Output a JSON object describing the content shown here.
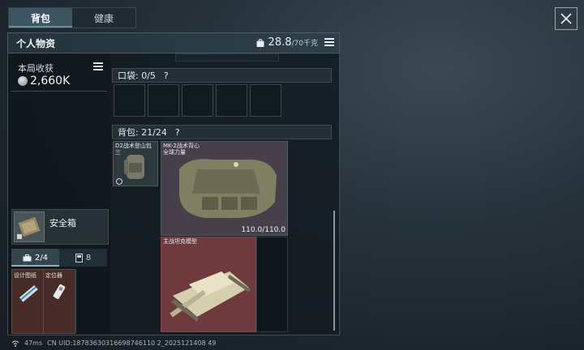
{
  "tabs": [
    {
      "label": "背包"
    },
    {
      "label": "健康"
    }
  ],
  "header": {
    "title": "个人物资",
    "weight_value": "28.8",
    "weight_max": "/70千克"
  },
  "earnings": {
    "label": "本局收获",
    "value": "2,660K"
  },
  "safebox": {
    "label": "安全箱"
  },
  "subtabs": [
    {
      "label": "2/4"
    },
    {
      "label": "8"
    }
  ],
  "tools": [
    {
      "label": "设计图纸"
    },
    {
      "label": "定位器"
    }
  ],
  "pockets": {
    "label": "口袋: 0/5",
    "help": "?"
  },
  "backpack": {
    "label": "背包: 21/24",
    "help": "?"
  },
  "items": {
    "backpack_item": {
      "label_line1": "D2战术登山包",
      "label_line2": "三"
    },
    "vest": {
      "label_line1": "MK-2战术背心",
      "label_line2": "全球力量",
      "durability": "110.0/110.0"
    },
    "tank": {
      "label": "主战坦克模型"
    }
  },
  "footer": {
    "ping": "47ms",
    "uid": "CN UID:18783630316698746110 2_2025121408 49"
  },
  "colors": {
    "tank_bg": "#6e3a3e",
    "vest_bg": "#4a3d4a",
    "tool_bg": "#743e34"
  }
}
